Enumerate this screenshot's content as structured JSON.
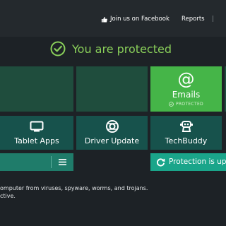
{
  "header": {
    "facebook_link": "Join us on Facebook",
    "reports_link": "Reports",
    "separator": "|"
  },
  "status": {
    "text": "You are protected",
    "icon": "check-circle-icon",
    "color": "#8ad05a"
  },
  "tiles": {
    "emails": {
      "icon_glyph": "@",
      "label": "Emails",
      "badge": "PROTECTED",
      "color": "#45b548"
    }
  },
  "apps": [
    {
      "label": "Tablet Apps",
      "icon": "tablet-icon"
    },
    {
      "label": "Driver Update",
      "icon": "driver-update-icon"
    },
    {
      "label": "TechBuddy",
      "icon": "techbuddy-icon"
    }
  ],
  "actions": {
    "menu_icon": "hamburger-menu-icon",
    "protection_button": "Protection is up"
  },
  "description": {
    "line1": "omputer from viruses, spyware, worms, and trojans.",
    "line2": "ctive."
  }
}
